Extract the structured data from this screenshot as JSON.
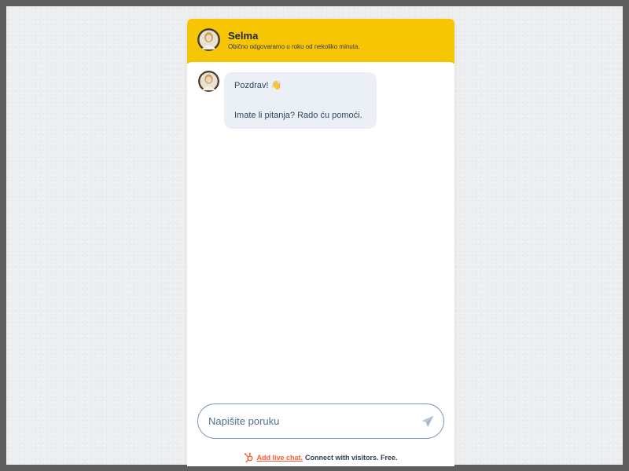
{
  "header": {
    "agent_name": "Selma",
    "subtitle": "Obično odgovaramo u roku od nekoliko minuta.",
    "background_color": "#f6c605"
  },
  "messages": [
    {
      "sender": "Selma",
      "lines": [
        "Pozdrav! 👋",
        "Imate li pitanja? Rado ću pomoći."
      ],
      "bubble_color": "#eaf0f6"
    }
  ],
  "composer": {
    "placeholder": "Napišite poruku",
    "value": "",
    "send_icon": "send-icon"
  },
  "footer": {
    "link_text": "Add live chat.",
    "text": "Connect with visitors. Free.",
    "icon": "hubspot-sprocket-icon",
    "link_color": "#ff5c35"
  }
}
